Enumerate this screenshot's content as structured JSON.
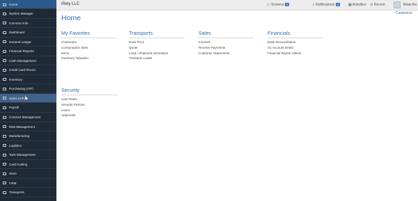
{
  "sidebar": {
    "items": [
      {
        "label": "Home",
        "icon": "home-icon"
      },
      {
        "label": "System Manager",
        "icon": "gear-icon"
      },
      {
        "label": "Common Info",
        "icon": "info-icon"
      },
      {
        "label": "Dashboard",
        "icon": "dashboard-icon"
      },
      {
        "label": "General Ledger",
        "icon": "ledger-icon"
      },
      {
        "label": "Financial Reports",
        "icon": "report-icon"
      },
      {
        "label": "Cash Management",
        "icon": "cash-icon"
      },
      {
        "label": "Credit Card Recon",
        "icon": "credit-card-icon"
      },
      {
        "label": "Inventory",
        "icon": "inventory-icon"
      },
      {
        "label": "Purchasing (A/P)",
        "icon": "purchasing-icon"
      },
      {
        "label": "Sales (A/R)",
        "icon": "sales-icon"
      },
      {
        "label": "Payroll",
        "icon": "payroll-icon"
      },
      {
        "label": "Contract Management",
        "icon": "contract-icon"
      },
      {
        "label": "Risk Management",
        "icon": "risk-icon"
      },
      {
        "label": "Manufacturing",
        "icon": "manufacturing-icon"
      },
      {
        "label": "Logistics",
        "icon": "logistics-icon"
      },
      {
        "label": "Tank Management",
        "icon": "tank-icon"
      },
      {
        "label": "Card Fueling",
        "icon": "fuel-icon"
      },
      {
        "label": "Store",
        "icon": "store-icon"
      },
      {
        "label": "CRM",
        "icon": "crm-icon"
      },
      {
        "label": "Transports",
        "icon": "truck-icon"
      }
    ]
  },
  "topbar": {
    "company": "iRely LLC",
    "screens_label": "Screens",
    "screens_count": "0",
    "notifications_label": "Notifications",
    "notifications_count": "0",
    "activities_label": "Activities",
    "recent_label": "Recent",
    "user_name": "Brian Ka"
  },
  "main": {
    "title": "Home",
    "customize_label": "Customize",
    "groups": [
      {
        "title": "My Favorites",
        "links": [
          "Customers",
          "Consumption Sites",
          "Items",
          "Inventory Valuation"
        ]
      },
      {
        "title": "Transports",
        "links": [
          "Rack Price",
          "Quote",
          "Load / Shipment Schedules",
          "Transport Loads"
        ]
      },
      {
        "title": "Sales",
        "links": [
          "Invoices",
          "Receive Payments",
          "Customer Statements"
        ]
      },
      {
        "title": "Financials",
        "links": [
          "Bank Reconciliation",
          "GL Account Detail",
          "Financial Report Viewer"
        ]
      },
      {
        "title": "Security",
        "links": [
          "User Roles",
          "Security Policies",
          "Users",
          "Approvals"
        ]
      }
    ]
  },
  "colors": {
    "sidebar_bg": "#1f2a37",
    "sidebar_active": "#2b5a8a",
    "accent": "#2a6db0"
  }
}
